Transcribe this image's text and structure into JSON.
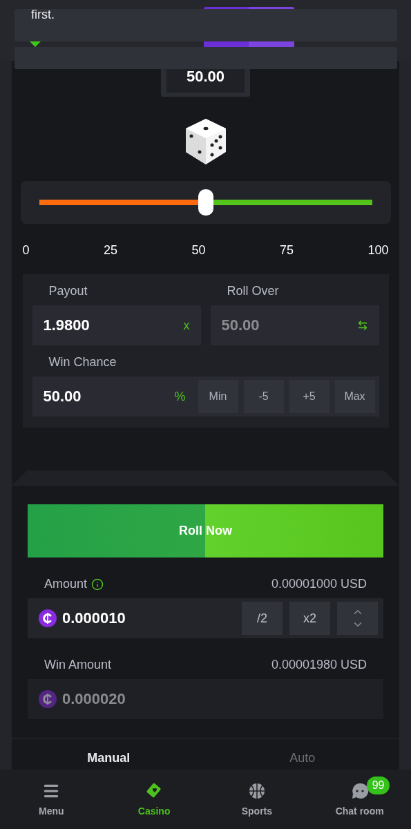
{
  "notice": {
    "text": "first."
  },
  "target_value": "50.00",
  "slider": {
    "level": 0.5,
    "ticks": [
      "0",
      "25",
      "50",
      "75",
      "100"
    ]
  },
  "payout": {
    "label": "Payout",
    "value": "1.9800",
    "suffix": "x"
  },
  "roll_over": {
    "label": "Roll Over",
    "value": "50.00"
  },
  "win_chance": {
    "label": "Win Chance",
    "value": "50.00",
    "suffix": "%",
    "buttons": [
      "Min",
      "-5",
      "+5",
      "Max"
    ]
  },
  "roll_button": "Roll Now",
  "amount": {
    "label": "Amount",
    "usd": "0.00001000 USD",
    "value": "0.000010",
    "buttons": [
      "/2",
      "x2"
    ]
  },
  "win_amount": {
    "label": "Win Amount",
    "usd": "0.00001980 USD",
    "value": "0.000020"
  },
  "mode_tabs": [
    {
      "label": "Manual",
      "selected": true
    },
    {
      "label": "Auto",
      "selected": false
    }
  ],
  "nav": [
    {
      "label": "Menu",
      "selected": false
    },
    {
      "label": "Casino",
      "selected": true
    },
    {
      "label": "Sports",
      "selected": false
    },
    {
      "label": "Chat room",
      "selected": false,
      "badge": "99"
    }
  ]
}
